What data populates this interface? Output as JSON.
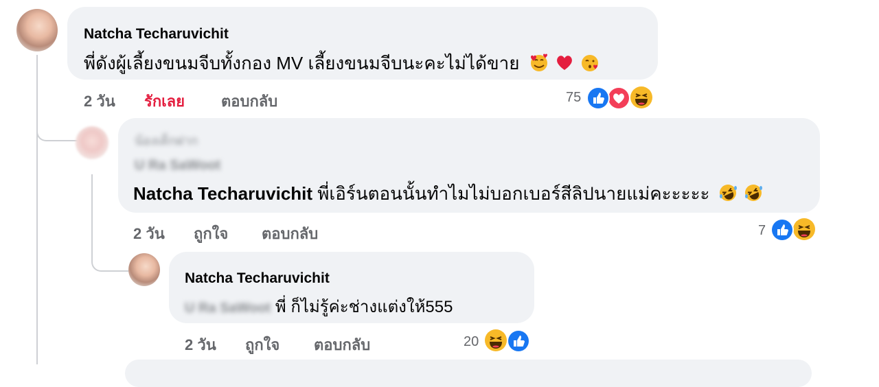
{
  "comments": [
    {
      "author": "Natcha Techaruvichit",
      "text": "พี่ดังผู้เลี้ยงขนมจีบทั้งกอง MV เลี้ยงขนมจีบนะคะไม่ได้ขาย",
      "time": "2 วัน",
      "like_label": "รักเลย",
      "reply_label": "ตอบกลับ",
      "reaction_count": "75",
      "reactions": [
        "like-icon",
        "love-icon",
        "haha-icon"
      ]
    },
    {
      "author_blurred": "น้องเด็กฝาก",
      "badge_blurred": "U Ra SaWoot",
      "mention": "Natcha Techaruvichit",
      "text": "พี่เอิร์นตอนนั้นทำไมไม่บอกเบอร์สีลิปนายแม่คะะะะะ",
      "time": "2 วัน",
      "like_label": "ถูกใจ",
      "reply_label": "ตอบกลับ",
      "reaction_count": "7",
      "reactions": [
        "like-icon",
        "haha-icon"
      ]
    },
    {
      "author": "Natcha Techaruvichit",
      "mention_blurred": "U Ra SaWoot",
      "text": "พี่ ก็ไม่รู้ค่ะช่างแต่งให้555",
      "time": "2 วัน",
      "like_label": "ถูกใจ",
      "reply_label": "ตอบกลับ",
      "reaction_count": "20",
      "reactions": [
        "haha-icon",
        "like-icon"
      ]
    }
  ],
  "colors": {
    "bubble_bg": "#f0f2f5",
    "meta_gray": "#65676b",
    "love_red": "#e41e3f",
    "like_blue": "#1877f2",
    "haha_yellow": "#f7b928"
  }
}
